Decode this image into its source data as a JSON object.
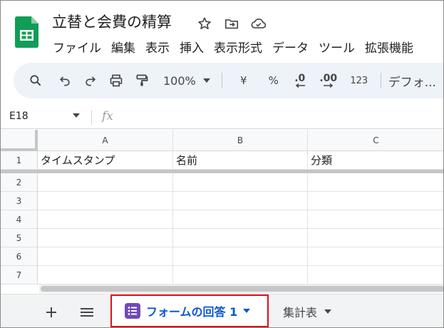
{
  "document": {
    "title": "立替と会費の精算"
  },
  "menu": [
    "ファイル",
    "編集",
    "表示",
    "挿入",
    "表示形式",
    "データ",
    "ツール",
    "拡張機能"
  ],
  "toolbar": {
    "zoom": "100%",
    "currency": "¥",
    "percent": "%",
    "decrease_decimal": ".0",
    "increase_decimal": ".00",
    "number_format": "123",
    "font": "デフォ..."
  },
  "formula_bar": {
    "cell_ref": "E18",
    "fx": "fx"
  },
  "grid": {
    "columns": [
      "A",
      "B",
      "C"
    ],
    "rows": [
      {
        "num": "1",
        "cells": [
          "タイムスタンプ",
          "名前",
          "分類"
        ]
      },
      {
        "num": "2",
        "cells": [
          "",
          "",
          ""
        ]
      },
      {
        "num": "3",
        "cells": [
          "",
          "",
          ""
        ]
      },
      {
        "num": "4",
        "cells": [
          "",
          "",
          ""
        ]
      },
      {
        "num": "5",
        "cells": [
          "",
          "",
          ""
        ]
      },
      {
        "num": "6",
        "cells": [
          "",
          "",
          ""
        ]
      },
      {
        "num": "7",
        "cells": [
          "",
          "",
          ""
        ]
      }
    ]
  },
  "sheets": {
    "add": "+",
    "active": "フォームの回答 1",
    "other": "集計表"
  },
  "colors": {
    "brand_green": "#0f9d58",
    "active_tab_text": "#0b57d0",
    "forms_purple": "#7248b9",
    "highlight_box": "#e0101a"
  }
}
